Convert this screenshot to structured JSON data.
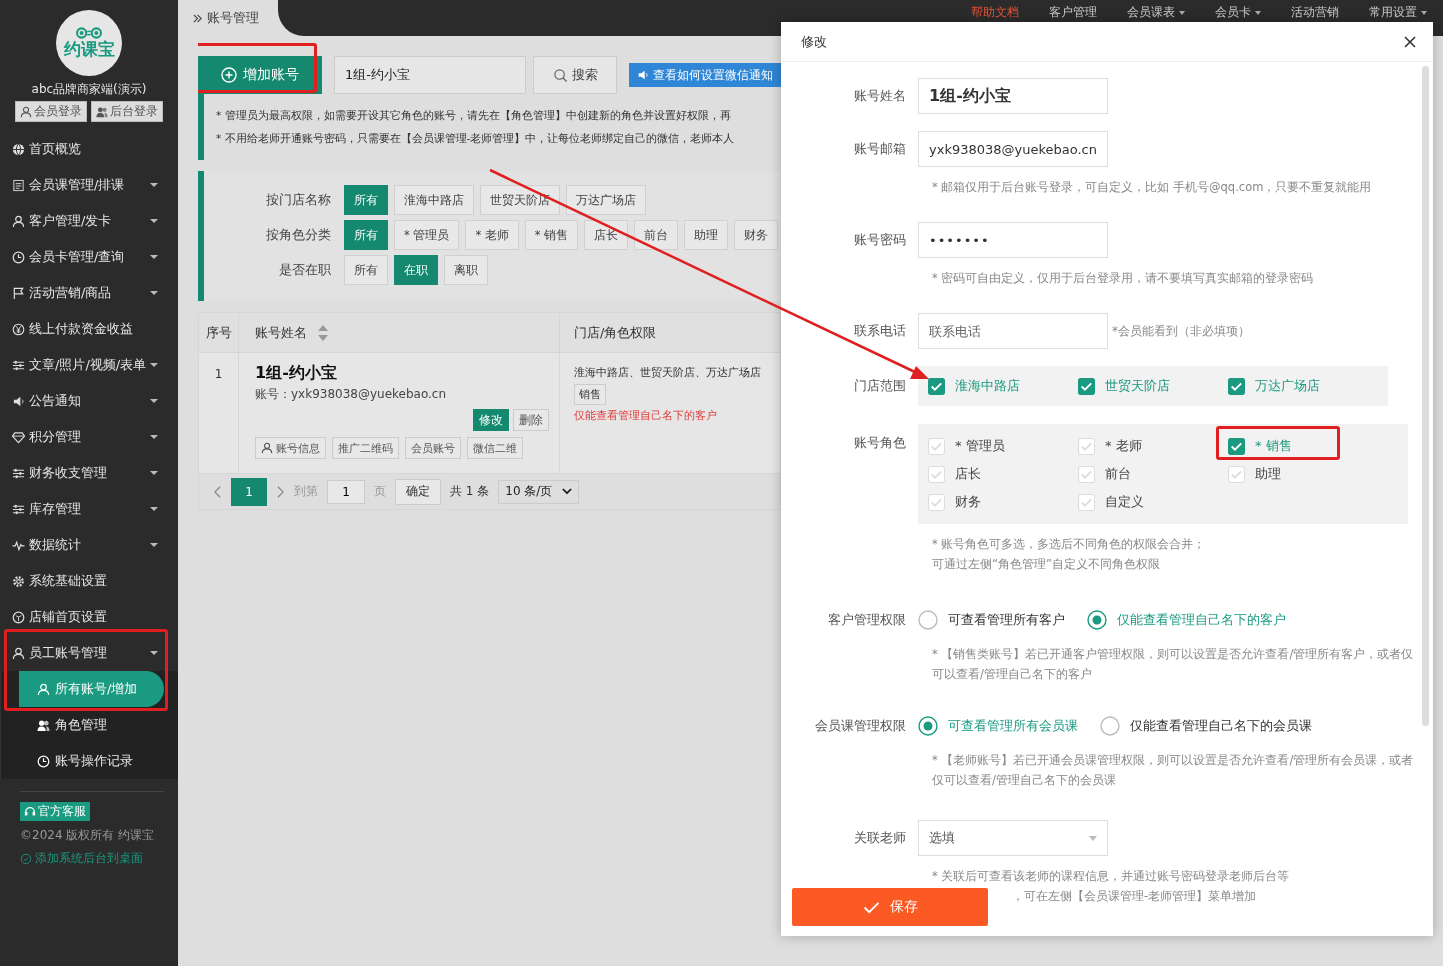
{
  "top_nav": [
    {
      "label": "帮助文档",
      "highlight": true,
      "dropdown": false
    },
    {
      "label": "客户管理",
      "highlight": false,
      "dropdown": false
    },
    {
      "label": "会员课表",
      "highlight": false,
      "dropdown": true
    },
    {
      "label": "会员卡",
      "highlight": false,
      "dropdown": true
    },
    {
      "label": "活动营销",
      "highlight": false,
      "dropdown": false
    },
    {
      "label": "常用设置",
      "highlight": false,
      "dropdown": true
    }
  ],
  "sidebar": {
    "logo": "约课宝",
    "brand": "abc品牌商家端(演示)",
    "login_buttons": [
      "会员登录",
      "后台登录"
    ],
    "items": [
      {
        "label": "首页概览",
        "has_submenu": false
      },
      {
        "label": "会员课管理/排课",
        "has_submenu": true
      },
      {
        "label": "客户管理/发卡",
        "has_submenu": true
      },
      {
        "label": "会员卡管理/查询",
        "has_submenu": true
      },
      {
        "label": "活动营销/商品",
        "has_submenu": true
      },
      {
        "label": "线上付款资金收益",
        "has_submenu": false
      },
      {
        "label": "文章/照片/视频/表单",
        "has_submenu": true
      },
      {
        "label": "公告通知",
        "has_submenu": true
      },
      {
        "label": "积分管理",
        "has_submenu": true
      },
      {
        "label": "财务收支管理",
        "has_submenu": true
      },
      {
        "label": "库存管理",
        "has_submenu": true
      },
      {
        "label": "数据统计",
        "has_submenu": true
      },
      {
        "label": "系统基础设置",
        "has_submenu": false
      },
      {
        "label": "店铺首页设置",
        "has_submenu": false
      },
      {
        "label": "员工账号管理",
        "has_submenu": true,
        "children": [
          {
            "label": "所有账号/增加",
            "selected": true
          },
          {
            "label": "角色管理",
            "selected": false
          },
          {
            "label": "账号操作记录",
            "selected": false
          }
        ]
      }
    ],
    "support_badge": "官方客服",
    "copyright": "©2024 版权所有 约课宝",
    "desktop_link": "添加系统后台到桌面"
  },
  "breadcrumb": "账号管理",
  "toolbar": {
    "add_button": "增加账号",
    "search": {
      "value": "1组-约小宝"
    },
    "search_button": "搜索",
    "help_button": "查看如何设置微信通知"
  },
  "notes": [
    "* 管理员为最高权限，如需要开设其它角色的账号，请先在【角色管理】中创建新的角色并设置好权限，再",
    "* 不用给老师开通账号密码，只需要在【会员课管理-老师管理】中，让每位老师绑定自己的微信，老师本人"
  ],
  "filters": [
    {
      "label": "按门店名称",
      "options": [
        {
          "label": "所有",
          "selected": true
        },
        {
          "label": "淮海中路店",
          "selected": false
        },
        {
          "label": "世贸天阶店",
          "selected": false
        },
        {
          "label": "万达广场店",
          "selected": false
        }
      ]
    },
    {
      "label": "按角色分类",
      "options": [
        {
          "label": "所有",
          "selected": true
        },
        {
          "label": "* 管理员",
          "selected": false
        },
        {
          "label": "* 老师",
          "selected": false
        },
        {
          "label": "* 销售",
          "selected": false
        },
        {
          "label": "店长",
          "selected": false
        },
        {
          "label": "前台",
          "selected": false
        },
        {
          "label": "助理",
          "selected": false
        },
        {
          "label": "财务",
          "selected": false
        }
      ]
    },
    {
      "label": "是否在职",
      "options": [
        {
          "label": "所有",
          "selected": false
        },
        {
          "label": "在职",
          "selected": true
        },
        {
          "label": "离职",
          "selected": false
        }
      ]
    }
  ],
  "table": {
    "columns": [
      "序号",
      "账号姓名",
      "门店/角色权限"
    ],
    "rows": [
      {
        "index": "1",
        "name": "1组-约小宝",
        "account": "账号：yxk938038@yuekebao.cn",
        "actions": [
          "修改",
          "删除"
        ],
        "links": [
          "账号信息",
          "推广二维码",
          "会员账号",
          "微信二维"
        ],
        "stores": "淮海中路店、世贸天阶店、万达广场店",
        "role": "销售",
        "permission": "仅能查看管理自己名下的客户"
      }
    ]
  },
  "pagination": {
    "current": "1",
    "goto_label": "到第",
    "goto_value": "1",
    "page_suffix": "页",
    "confirm": "确定",
    "total": "共 1 条",
    "page_size": "10 条/页"
  },
  "modal": {
    "title": "修改",
    "name": {
      "label": "账号姓名",
      "value": "1组-约小宝"
    },
    "email": {
      "label": "账号邮箱",
      "value": "yxk938038@yuekebao.cn",
      "hint": "* 邮箱仅用于后台账号登录，可自定义，比如 手机号@qq.com，只要不重复就能用"
    },
    "password": {
      "label": "账号密码",
      "value": "•••••••",
      "hint": "* 密码可自由定义，仅用于后台登录用，请不要填写真实邮箱的登录密码"
    },
    "phone": {
      "label": "联系电话",
      "placeholder": "联系电话",
      "note": "*会员能看到（非必填项）"
    },
    "stores": {
      "label": "门店范围",
      "options": [
        {
          "label": "淮海中路店",
          "checked": true
        },
        {
          "label": "世贸天阶店",
          "checked": true
        },
        {
          "label": "万达广场店",
          "checked": true
        }
      ]
    },
    "roles": {
      "label": "账号角色",
      "options": [
        {
          "label": "* 管理员",
          "checked": false
        },
        {
          "label": "* 老师",
          "checked": false
        },
        {
          "label": "* 销售",
          "checked": true
        },
        {
          "label": "店长",
          "checked": false
        },
        {
          "label": "前台",
          "checked": false
        },
        {
          "label": "助理",
          "checked": false
        },
        {
          "label": "财务",
          "checked": false
        },
        {
          "label": "自定义",
          "checked": false
        }
      ],
      "hints": [
        "* 账号角色可多选，多选后不同角色的权限会合并；",
        "可通过左侧“角色管理”自定义不同角色权限"
      ]
    },
    "permissions": [
      {
        "label": "客户管理权限",
        "options": [
          {
            "label": "可查看管理所有客户",
            "selected": false
          },
          {
            "label": "仅能查看管理自己名下的客户",
            "selected": true
          }
        ],
        "hint": "* 【销售类账号】若已开通客户管理权限，则可以设置是否允许查看/管理所有客户，或者仅可以查看/管理自己名下的客户"
      },
      {
        "label": "会员课管理权限",
        "options": [
          {
            "label": "可查看管理所有会员课",
            "selected": true
          },
          {
            "label": "仅能查看管理自己名下的会员课",
            "selected": false
          }
        ],
        "hint": "* 【老师账号】若已开通会员课管理权限，则可以设置是否允许查看/管理所有会员课，或者仅可以查看/管理自己名下的会员课"
      }
    ],
    "teacher": {
      "label": "关联老师",
      "placeholder": "选填",
      "hints": [
        "* 关联后可查看该老师的课程信息，并通过账号密码登录老师后台等",
        "，可在左侧【会员课管理-老师管理】菜单增加"
      ]
    },
    "save_button": "保存"
  }
}
